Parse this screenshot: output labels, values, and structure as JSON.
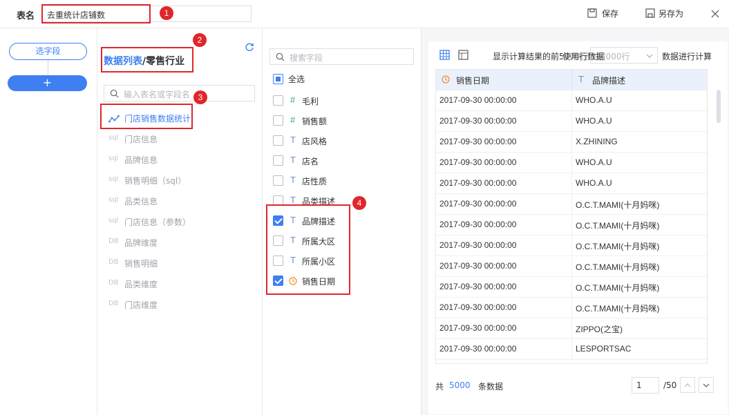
{
  "header": {
    "table_name_label": "表名",
    "table_name_value": "去重统计店铺数",
    "save_label": "保存",
    "save_as_label": "另存为"
  },
  "left": {
    "select_field_btn": "选字段",
    "add_btn": "+"
  },
  "datalist": {
    "title_prefix": "数据列表",
    "title_suffix": "/零售行业",
    "search_placeholder": "输入表名或字段名",
    "items": [
      {
        "tag": "",
        "label": "门店销售数据统计"
      },
      {
        "tag": "sql",
        "label": "门店信息"
      },
      {
        "tag": "sql",
        "label": "品牌信息"
      },
      {
        "tag": "sql",
        "label": "销售明细（sql）"
      },
      {
        "tag": "sql",
        "label": "品类信息"
      },
      {
        "tag": "sql",
        "label": "门店信息（参数）"
      },
      {
        "tag": "DB",
        "label": "品牌维度"
      },
      {
        "tag": "DB",
        "label": "销售明细"
      },
      {
        "tag": "DB",
        "label": "品类维度"
      },
      {
        "tag": "DB",
        "label": "门店维度"
      }
    ]
  },
  "fields": {
    "search_placeholder": "搜索字段",
    "select_all": "全选",
    "items": [
      {
        "type": "#",
        "label": "毛利",
        "checked": false
      },
      {
        "type": "#",
        "label": "销售额",
        "checked": false
      },
      {
        "type": "T",
        "label": "店风格",
        "checked": false
      },
      {
        "type": "T",
        "label": "店名",
        "checked": false
      },
      {
        "type": "T",
        "label": "店性质",
        "checked": false
      },
      {
        "type": "T",
        "label": "品类描述",
        "checked": false
      },
      {
        "type": "T",
        "label": "品牌描述",
        "checked": true
      },
      {
        "type": "T",
        "label": "所属大区",
        "checked": false
      },
      {
        "type": "T",
        "label": "所属小区",
        "checked": false
      },
      {
        "type": "clock",
        "label": "销售日期",
        "checked": true
      }
    ]
  },
  "preview": {
    "toolbar_text1": "显示计算结果的前5000行数据",
    "toolbar_overlap": "使用行数据",
    "rows_select": "5000行",
    "toolbar_text2": "数据进行计算",
    "columns": [
      {
        "type": "clock",
        "label": "销售日期"
      },
      {
        "type": "T",
        "label": "品牌描述"
      }
    ],
    "rows": [
      [
        "2017-09-30 00:00:00",
        "WHO.A.U"
      ],
      [
        "2017-09-30 00:00:00",
        "WHO.A.U"
      ],
      [
        "2017-09-30 00:00:00",
        "X.ZHINING"
      ],
      [
        "2017-09-30 00:00:00",
        "WHO.A.U"
      ],
      [
        "2017-09-30 00:00:00",
        "WHO.A.U"
      ],
      [
        "2017-09-30 00:00:00",
        "O.C.T.MAMI(十月妈咪)"
      ],
      [
        "2017-09-30 00:00:00",
        "O.C.T.MAMI(十月妈咪)"
      ],
      [
        "2017-09-30 00:00:00",
        "O.C.T.MAMI(十月妈咪)"
      ],
      [
        "2017-09-30 00:00:00",
        "O.C.T.MAMI(十月妈咪)"
      ],
      [
        "2017-09-30 00:00:00",
        "O.C.T.MAMI(十月妈咪)"
      ],
      [
        "2017-09-30 00:00:00",
        "O.C.T.MAMI(十月妈咪)"
      ],
      [
        "2017-09-30 00:00:00",
        "ZIPPO(之宝)"
      ],
      [
        "2017-09-30 00:00:00",
        "LESPORTSAC"
      ]
    ],
    "footer_prefix": "共",
    "footer_count": "5000",
    "footer_suffix": "条数据",
    "page_value": "1",
    "page_total": "/50"
  },
  "annotations": [
    "1",
    "2",
    "3",
    "4"
  ],
  "colors": {
    "accent": "#3e7ff2",
    "annotation": "#e0262b"
  }
}
